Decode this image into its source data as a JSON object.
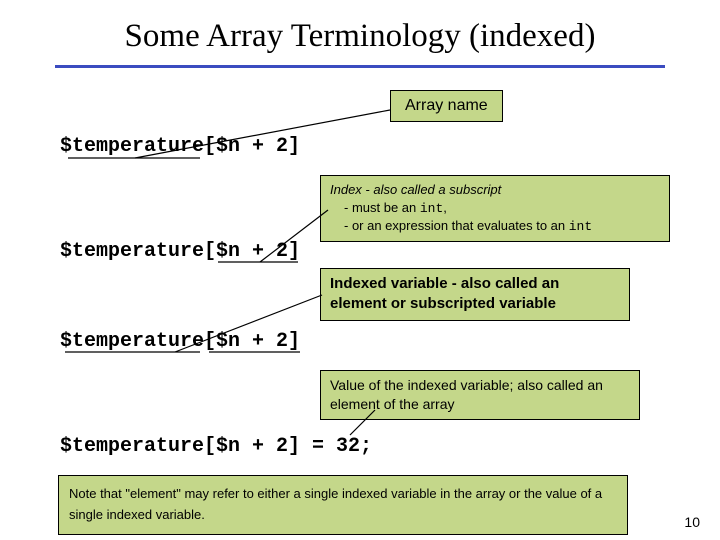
{
  "title": "Some Array Terminology (indexed)",
  "code": {
    "line1": "$temperature[$n + 2]",
    "line2": "$temperature[$n + 2]",
    "line3": "$temperature[$n + 2]",
    "line4": "$temperature[$n + 2] = 32;"
  },
  "annotations": {
    "array_name": "Array name",
    "index_title": "Index - also called a subscript",
    "index_bullet1": "- must be an ",
    "index_int1": "int",
    "index_bullet1_cont": ",",
    "index_bullet2": "- or an expression that evaluates to an ",
    "index_int2": "int",
    "indexed_var": "Indexed variable - also called an element or subscripted variable",
    "value_text": "Value of the indexed variable;  also called an element of the array",
    "note": "Note that \"element\" may refer to either a single indexed variable in the array or the value of a single indexed variable."
  },
  "page_number": "10"
}
